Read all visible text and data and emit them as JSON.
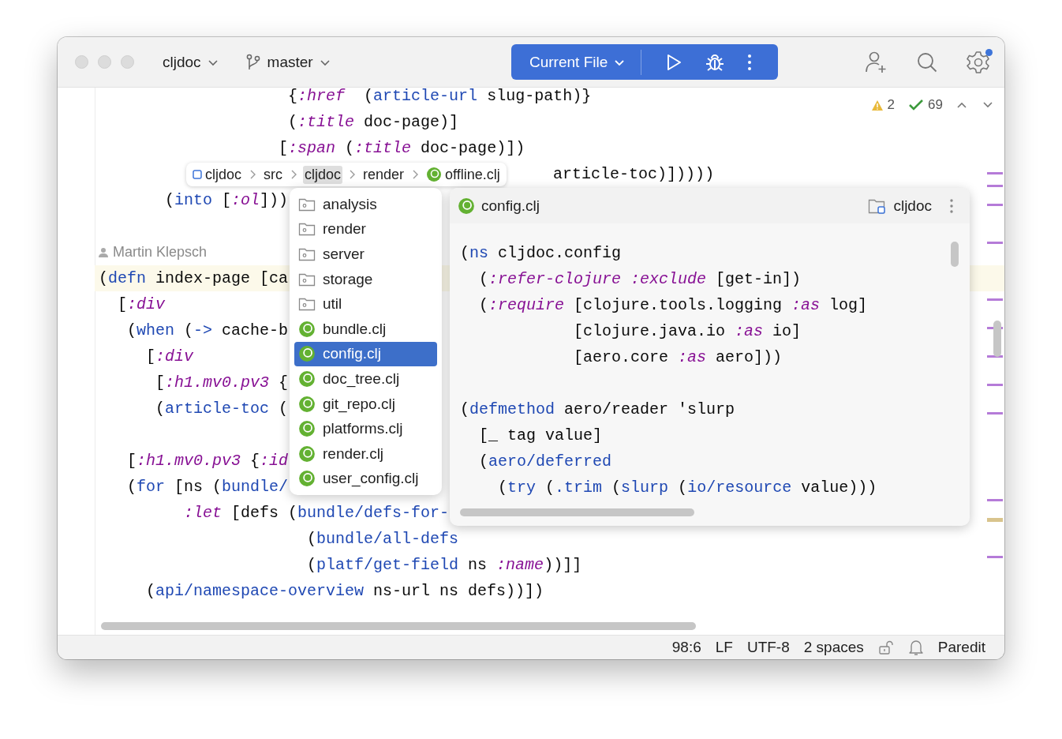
{
  "toolbar": {
    "project": "cljdoc",
    "branch": "master",
    "run_config": "Current File",
    "settings_badge": true
  },
  "editor": {
    "inspections": {
      "warnings": "2",
      "passed": "69"
    },
    "lines": [
      {
        "kind": "code",
        "current": false,
        "tokens": [
          {
            "kind": "plain",
            "text": "                    {"
          },
          {
            "kind": "keyword",
            "text": ":href"
          },
          {
            "kind": "plain",
            "text": "  ("
          },
          {
            "kind": "symbol",
            "text": "article-url"
          },
          {
            "kind": "plain",
            "text": " slug-path)}"
          }
        ]
      },
      {
        "kind": "code",
        "current": false,
        "tokens": [
          {
            "kind": "plain",
            "text": "                    ("
          },
          {
            "kind": "keyword",
            "text": ":title"
          },
          {
            "kind": "plain",
            "text": " doc-page)]"
          }
        ]
      },
      {
        "kind": "code",
        "current": false,
        "tokens": [
          {
            "kind": "plain",
            "text": "                   ["
          },
          {
            "kind": "keyword",
            "text": ":span"
          },
          {
            "kind": "plain",
            "text": " ("
          },
          {
            "kind": "keyword",
            "text": ":title"
          },
          {
            "kind": "plain",
            "text": " doc-page)])"
          }
        ]
      },
      {
        "kind": "code",
        "current": false,
        "tokens": [
          {
            "kind": "plain",
            "text": "                                                article-toc)]))))"
          }
        ]
      },
      {
        "kind": "code",
        "current": false,
        "tokens": [
          {
            "kind": "plain",
            "text": "       ("
          },
          {
            "kind": "symbol",
            "text": "into"
          },
          {
            "kind": "plain",
            "text": " ["
          },
          {
            "kind": "keyword",
            "text": ":ol"
          },
          {
            "kind": "plain",
            "text": "]))"
          }
        ]
      },
      {
        "kind": "blank",
        "current": false
      },
      {
        "kind": "blame",
        "current": false,
        "text": "Martin Klepsch"
      },
      {
        "kind": "code",
        "current": true,
        "tokens": [
          {
            "kind": "plain",
            "text": "("
          },
          {
            "kind": "symbol",
            "text": "defn"
          },
          {
            "kind": "plain",
            "text": " index-page [ca"
          }
        ]
      },
      {
        "kind": "code",
        "current": false,
        "tokens": [
          {
            "kind": "plain",
            "text": "  ["
          },
          {
            "kind": "keyword",
            "text": ":div"
          }
        ]
      },
      {
        "kind": "code",
        "current": false,
        "tokens": [
          {
            "kind": "plain",
            "text": "   ("
          },
          {
            "kind": "symbol",
            "text": "when"
          },
          {
            "kind": "plain",
            "text": " ("
          },
          {
            "kind": "symbol",
            "text": "->"
          },
          {
            "kind": "plain",
            "text": " cache-b"
          }
        ]
      },
      {
        "kind": "code",
        "current": false,
        "tokens": [
          {
            "kind": "plain",
            "text": "     ["
          },
          {
            "kind": "keyword",
            "text": ":div"
          }
        ]
      },
      {
        "kind": "code",
        "current": false,
        "tokens": [
          {
            "kind": "plain",
            "text": "      ["
          },
          {
            "kind": "keyword",
            "text": ":h1.mv0.pv3"
          },
          {
            "kind": "plain",
            "text": " {"
          }
        ]
      },
      {
        "kind": "code",
        "current": false,
        "tokens": [
          {
            "kind": "plain",
            "text": "      ("
          },
          {
            "kind": "symbol",
            "text": "article-toc"
          },
          {
            "kind": "plain",
            "text": " ("
          }
        ]
      },
      {
        "kind": "blank",
        "current": false
      },
      {
        "kind": "code",
        "current": false,
        "tokens": [
          {
            "kind": "plain",
            "text": "   ["
          },
          {
            "kind": "keyword",
            "text": ":h1.mv0.pv3"
          },
          {
            "kind": "plain",
            "text": " {"
          },
          {
            "kind": "keyword",
            "text": ":id"
          }
        ]
      },
      {
        "kind": "code",
        "current": false,
        "tokens": [
          {
            "kind": "plain",
            "text": "   ("
          },
          {
            "kind": "symbol",
            "text": "for"
          },
          {
            "kind": "plain",
            "text": " [ns ("
          },
          {
            "kind": "symbol",
            "text": "bundle/"
          }
        ]
      },
      {
        "kind": "code",
        "current": false,
        "tokens": [
          {
            "kind": "keyword",
            "text": "         :let"
          },
          {
            "kind": "plain",
            "text": " [defs ("
          },
          {
            "kind": "symbol",
            "text": "bundle/defs-for-"
          }
        ]
      },
      {
        "kind": "code",
        "current": false,
        "tokens": [
          {
            "kind": "plain",
            "text": "                      ("
          },
          {
            "kind": "symbol",
            "text": "bundle/all-defs"
          }
        ]
      },
      {
        "kind": "code",
        "current": false,
        "tokens": [
          {
            "kind": "plain",
            "text": "                      ("
          },
          {
            "kind": "symbol",
            "text": "platf/get-field"
          },
          {
            "kind": "plain",
            "text": " ns "
          },
          {
            "kind": "keyword",
            "text": ":name"
          },
          {
            "kind": "plain",
            "text": "))]]"
          }
        ]
      },
      {
        "kind": "code",
        "current": false,
        "tokens": [
          {
            "kind": "plain",
            "text": "     ("
          },
          {
            "kind": "symbol",
            "text": "api/namespace-overview"
          },
          {
            "kind": "plain",
            "text": " ns-url ns defs))])"
          }
        ]
      }
    ]
  },
  "breadcrumbs": [
    {
      "label": "cljdoc",
      "kind": "module",
      "selected": false
    },
    {
      "label": "src",
      "kind": "plain",
      "selected": false
    },
    {
      "label": "cljdoc",
      "kind": "plain",
      "selected": true
    },
    {
      "label": "render",
      "kind": "plain",
      "selected": false
    },
    {
      "label": "offline.clj",
      "kind": "clojure",
      "selected": false
    }
  ],
  "file_list": [
    {
      "name": "analysis",
      "kind": "folder",
      "selected": false
    },
    {
      "name": "render",
      "kind": "folder",
      "selected": false
    },
    {
      "name": "server",
      "kind": "folder",
      "selected": false
    },
    {
      "name": "storage",
      "kind": "folder",
      "selected": false
    },
    {
      "name": "util",
      "kind": "folder",
      "selected": false
    },
    {
      "name": "bundle.clj",
      "kind": "clojure",
      "selected": false
    },
    {
      "name": "config.clj",
      "kind": "clojure",
      "selected": true
    },
    {
      "name": "doc_tree.clj",
      "kind": "clojure",
      "selected": false
    },
    {
      "name": "git_repo.clj",
      "kind": "clojure",
      "selected": false
    },
    {
      "name": "platforms.clj",
      "kind": "clojure",
      "selected": false
    },
    {
      "name": "render.clj",
      "kind": "clojure",
      "selected": false
    },
    {
      "name": "user_config.clj",
      "kind": "clojure",
      "selected": false
    }
  ],
  "preview": {
    "file": "config.clj",
    "module": "cljdoc",
    "lines": [
      {
        "kind": "code",
        "tokens": [
          {
            "kind": "plain",
            "text": "("
          },
          {
            "kind": "symbol",
            "text": "ns"
          },
          {
            "kind": "plain",
            "text": " cljdoc.config"
          }
        ]
      },
      {
        "kind": "code",
        "tokens": [
          {
            "kind": "plain",
            "text": "  ("
          },
          {
            "kind": "keyword",
            "text": ":refer-clojure "
          },
          {
            "kind": "keyword",
            "text": ":exclude"
          },
          {
            "kind": "plain",
            "text": " [get-in])"
          }
        ]
      },
      {
        "kind": "code",
        "tokens": [
          {
            "kind": "plain",
            "text": "  ("
          },
          {
            "kind": "keyword",
            "text": ":require"
          },
          {
            "kind": "plain",
            "text": " [clojure.tools.logging "
          },
          {
            "kind": "keyword",
            "text": ":as"
          },
          {
            "kind": "plain",
            "text": " log]"
          }
        ]
      },
      {
        "kind": "code",
        "tokens": [
          {
            "kind": "plain",
            "text": "            [clojure.java.io "
          },
          {
            "kind": "keyword",
            "text": ":as"
          },
          {
            "kind": "plain",
            "text": " io]"
          }
        ]
      },
      {
        "kind": "code",
        "tokens": [
          {
            "kind": "plain",
            "text": "            [aero.core "
          },
          {
            "kind": "keyword",
            "text": ":as"
          },
          {
            "kind": "plain",
            "text": " aero]))"
          }
        ]
      },
      {
        "kind": "blank"
      },
      {
        "kind": "code",
        "tokens": [
          {
            "kind": "plain",
            "text": "("
          },
          {
            "kind": "symbol",
            "text": "defmethod"
          },
          {
            "kind": "plain",
            "text": " aero/reader 'slurp"
          }
        ]
      },
      {
        "kind": "code",
        "tokens": [
          {
            "kind": "plain",
            "text": "  [_ tag value]"
          }
        ]
      },
      {
        "kind": "code",
        "tokens": [
          {
            "kind": "plain",
            "text": "  ("
          },
          {
            "kind": "symbol",
            "text": "aero/deferred"
          }
        ]
      },
      {
        "kind": "code",
        "tokens": [
          {
            "kind": "plain",
            "text": "    ("
          },
          {
            "kind": "symbol",
            "text": "try"
          },
          {
            "kind": "plain",
            "text": " ("
          },
          {
            "kind": "symbol",
            "text": ".trim"
          },
          {
            "kind": "plain",
            "text": " ("
          },
          {
            "kind": "symbol",
            "text": "slurp"
          },
          {
            "kind": "plain",
            "text": " ("
          },
          {
            "kind": "symbol",
            "text": "io/resource"
          },
          {
            "kind": "plain",
            "text": " value)))"
          }
        ]
      }
    ]
  },
  "status_bar": {
    "position": "98:6",
    "line_ending": "LF",
    "encoding": "UTF-8",
    "indent": "2 spaces",
    "mode": "Paredit"
  }
}
